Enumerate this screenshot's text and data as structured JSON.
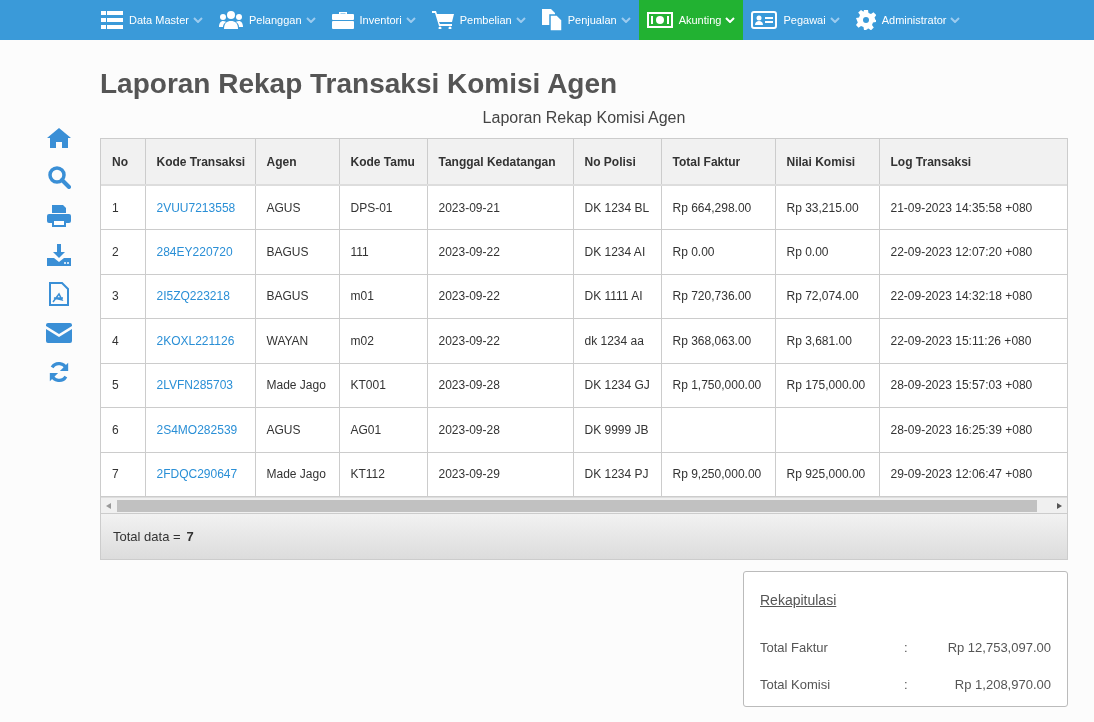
{
  "nav": [
    {
      "label": "Data Master",
      "selected": false
    },
    {
      "label": "Pelanggan",
      "selected": false
    },
    {
      "label": "Inventori",
      "selected": false
    },
    {
      "label": "Pembelian",
      "selected": false
    },
    {
      "label": "Penjualan",
      "selected": false
    },
    {
      "label": "Akunting",
      "selected": true
    },
    {
      "label": "Pegawai",
      "selected": false
    },
    {
      "label": "Administrator",
      "selected": false
    }
  ],
  "page_title": "Laporan Rekap Transaksi Komisi Agen",
  "report_title": "Laporan Rekap Komisi Agen",
  "table": {
    "columns": [
      "No",
      "Kode Transaksi",
      "Agen",
      "Kode Tamu",
      "Tanggal Kedatangan",
      "No Polisi",
      "Total Faktur",
      "Nilai Komisi",
      "Log Transaksi"
    ],
    "rows": [
      [
        "1",
        "2VUU7213558",
        "AGUS",
        "DPS-01",
        "2023-09-21",
        "DK 1234 BL",
        "Rp 664,298.00",
        "Rp 33,215.00",
        "21-09-2023 14:35:58 +080"
      ],
      [
        "2",
        "284EY220720",
        "BAGUS",
        "111",
        "2023-09-22",
        "DK 1234 AI",
        "Rp 0.00",
        "Rp 0.00",
        "22-09-2023 12:07:20 +080"
      ],
      [
        "3",
        "2I5ZQ223218",
        "BAGUS",
        "m01",
        "2023-09-22",
        "DK 1111 AI",
        "Rp 720,736.00",
        "Rp 72,074.00",
        "22-09-2023 14:32:18 +080"
      ],
      [
        "4",
        "2KOXL221126",
        "WAYAN",
        "m02",
        "2023-09-22",
        "dk 1234 aa",
        "Rp 368,063.00",
        "Rp 3,681.00",
        "22-09-2023 15:11:26 +080"
      ],
      [
        "5",
        "2LVFN285703",
        "Made Jago",
        "KT001",
        "2023-09-28",
        "DK 1234 GJ",
        "Rp 1,750,000.00",
        "Rp 175,000.00",
        "28-09-2023 15:57:03 +080"
      ],
      [
        "6",
        "2S4MO282539",
        "AGUS",
        "AG01",
        "2023-09-28",
        "DK 9999 JB",
        "",
        "",
        "28-09-2023 16:25:39 +080"
      ],
      [
        "7",
        "2FDQC290647",
        "Made Jago",
        "KT112",
        "2023-09-29",
        "DK 1234 PJ",
        "Rp 9,250,000.00",
        "Rp 925,000.00",
        "29-09-2023 12:06:47 +080"
      ]
    ],
    "footer_label": "Total data =",
    "footer_count": "7"
  },
  "summary": {
    "title": "Rekapitulasi",
    "rows": [
      {
        "label": "Total Faktur",
        "separator": ":",
        "value": "Rp 12,753,097.00"
      },
      {
        "label": "Total Komisi",
        "separator": ":",
        "value": "Rp 1,208,970.00"
      }
    ]
  }
}
